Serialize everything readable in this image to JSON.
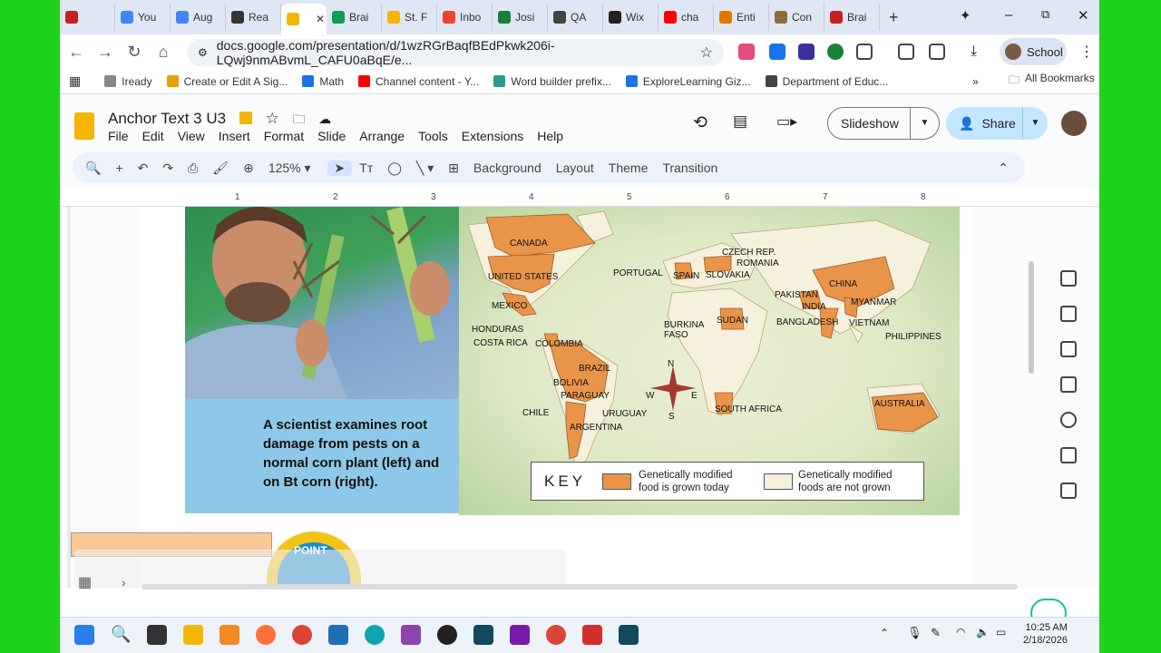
{
  "tabs": [
    {
      "label": "",
      "color": "#c5221f"
    },
    {
      "label": "You",
      "color": "#4285f4"
    },
    {
      "label": "Aug",
      "color": "#4285f4"
    },
    {
      "label": "Rea",
      "color": "#333333"
    },
    {
      "label": "",
      "color": "#f4b400"
    },
    {
      "label": "Brai",
      "color": "#0f9d58"
    },
    {
      "label": "St. F",
      "color": "#f4b400"
    },
    {
      "label": "Inbo",
      "color": "#ea4335"
    },
    {
      "label": "Josi",
      "color": "#188038"
    },
    {
      "label": "QA",
      "color": "#444444"
    },
    {
      "label": "Wix",
      "color": "#222222"
    },
    {
      "label": "cha",
      "color": "#ff0000"
    },
    {
      "label": "Enti",
      "color": "#e37400"
    },
    {
      "label": "Con",
      "color": "#8a6d3b"
    },
    {
      "label": "Brai",
      "color": "#c5221f"
    }
  ],
  "window": {
    "minimize": "–",
    "maximize": "⧉",
    "close": "✕",
    "new_tab": "+"
  },
  "address": {
    "url": "docs.google.com/presentation/d/1wzRGrBaqfBEdPkwk206i-LQwj9nmABvmL_CAFU0aBqE/e..."
  },
  "profile": {
    "label": "School"
  },
  "bookmarks": [
    "Iready",
    "Create or Edit A Sig...",
    "Math",
    "Channel content - Y...",
    "Word builder prefix...",
    "ExploreLearning Giz...",
    "Department of Educ..."
  ],
  "bookmarks_all": "All Bookmarks",
  "doc": {
    "title": "Anchor Text 3 U3",
    "menus": [
      "File",
      "Edit",
      "View",
      "Insert",
      "Format",
      "Slide",
      "Arrange",
      "Tools",
      "Extensions",
      "Help"
    ],
    "slideshow": "Slideshow",
    "share": "Share"
  },
  "toolbar": {
    "zoom": "125%",
    "background": "Background",
    "layout": "Layout",
    "theme": "Theme",
    "transition": "Transition"
  },
  "ruler": [
    "1",
    "2",
    "3",
    "4",
    "5",
    "6",
    "7",
    "8"
  ],
  "slide": {
    "caption": "A scientist examines root damage from pests on a normal corn plant (left) and on Bt corn (right).",
    "map_labels": [
      "CANADA",
      "UNITED STATES",
      "MEXICO",
      "HONDURAS",
      "COSTA RICA",
      "COLOMBIA",
      "BRAZIL",
      "BOLIVIA",
      "PARAGUAY",
      "CHILE",
      "URUGUAY",
      "ARGENTINA",
      "PORTUGAL",
      "SPAIN",
      "SLOVAKIA",
      "CZECH REP.",
      "ROMANIA",
      "BURKINA FASO",
      "SUDAN",
      "SOUTH AFRICA",
      "PAKISTAN",
      "INDIA",
      "CHINA",
      "BANGLADESH",
      "MYANMAR",
      "VIETNAM",
      "PHILIPPINES",
      "AUSTRALIA"
    ],
    "compass": {
      "n": "N",
      "s": "S",
      "e": "E",
      "w": "W"
    },
    "key": {
      "title": "KEY",
      "grown": "Genetically modified food is grown today",
      "not_grown": "Genetically modified foods are not grown"
    },
    "sticker": "POINT"
  },
  "colors": {
    "gm": "#e8954a",
    "not_gm": "#f6f1dc",
    "frame": "#1ed21e"
  },
  "taskbar": {
    "time": "10:25 AM",
    "date": "2/18/2026"
  }
}
